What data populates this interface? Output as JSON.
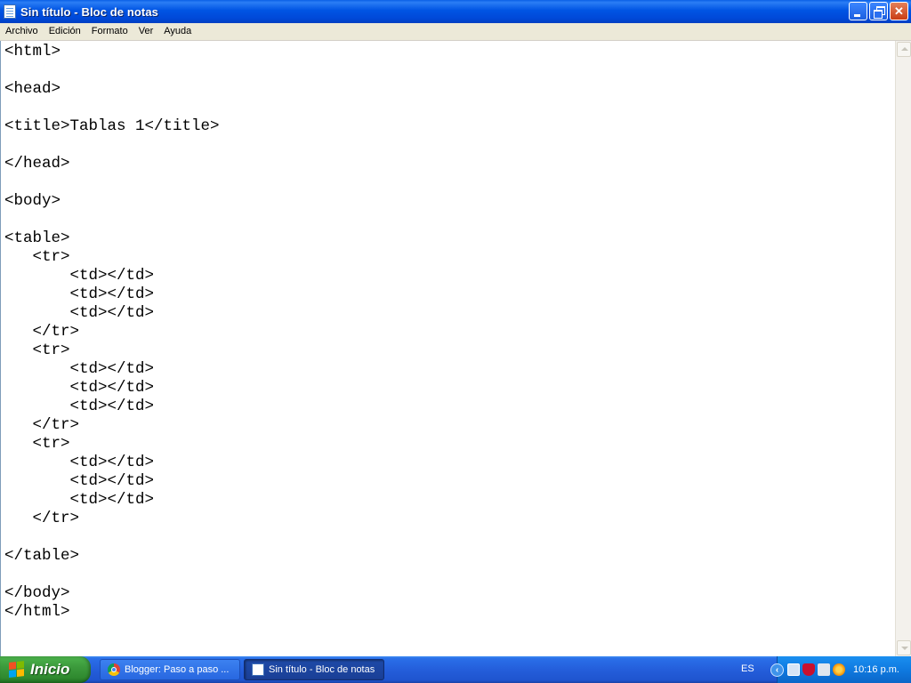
{
  "window": {
    "title": "Sin título - Bloc de notas"
  },
  "menu": [
    "Archivo",
    "Edición",
    "Formato",
    "Ver",
    "Ayuda"
  ],
  "editor": {
    "lines": [
      "<html>",
      "",
      "<head>",
      "",
      "<title>Tablas 1</title>",
      "",
      "</head>",
      "",
      "<body>",
      "",
      "<table>",
      "   <tr>",
      "       <td></td>",
      "       <td></td>",
      "       <td></td>",
      "   </tr>",
      "   <tr>",
      "       <td></td>",
      "       <td></td>",
      "       <td></td>",
      "   </tr>",
      "   <tr>",
      "       <td></td>",
      "       <td></td>",
      "       <td></td>",
      "   </tr>",
      "",
      "</table>",
      "",
      "</body>",
      "</html>"
    ]
  },
  "taskbar": {
    "start_label": "Inicio",
    "tasks": [
      {
        "label": "Blogger: Paso a paso ...",
        "icon": "chrome-icon"
      },
      {
        "label": "Sin título - Bloc de notas",
        "icon": "notepad-icon"
      }
    ],
    "language": "ES",
    "clock": "10:16 p.m."
  }
}
